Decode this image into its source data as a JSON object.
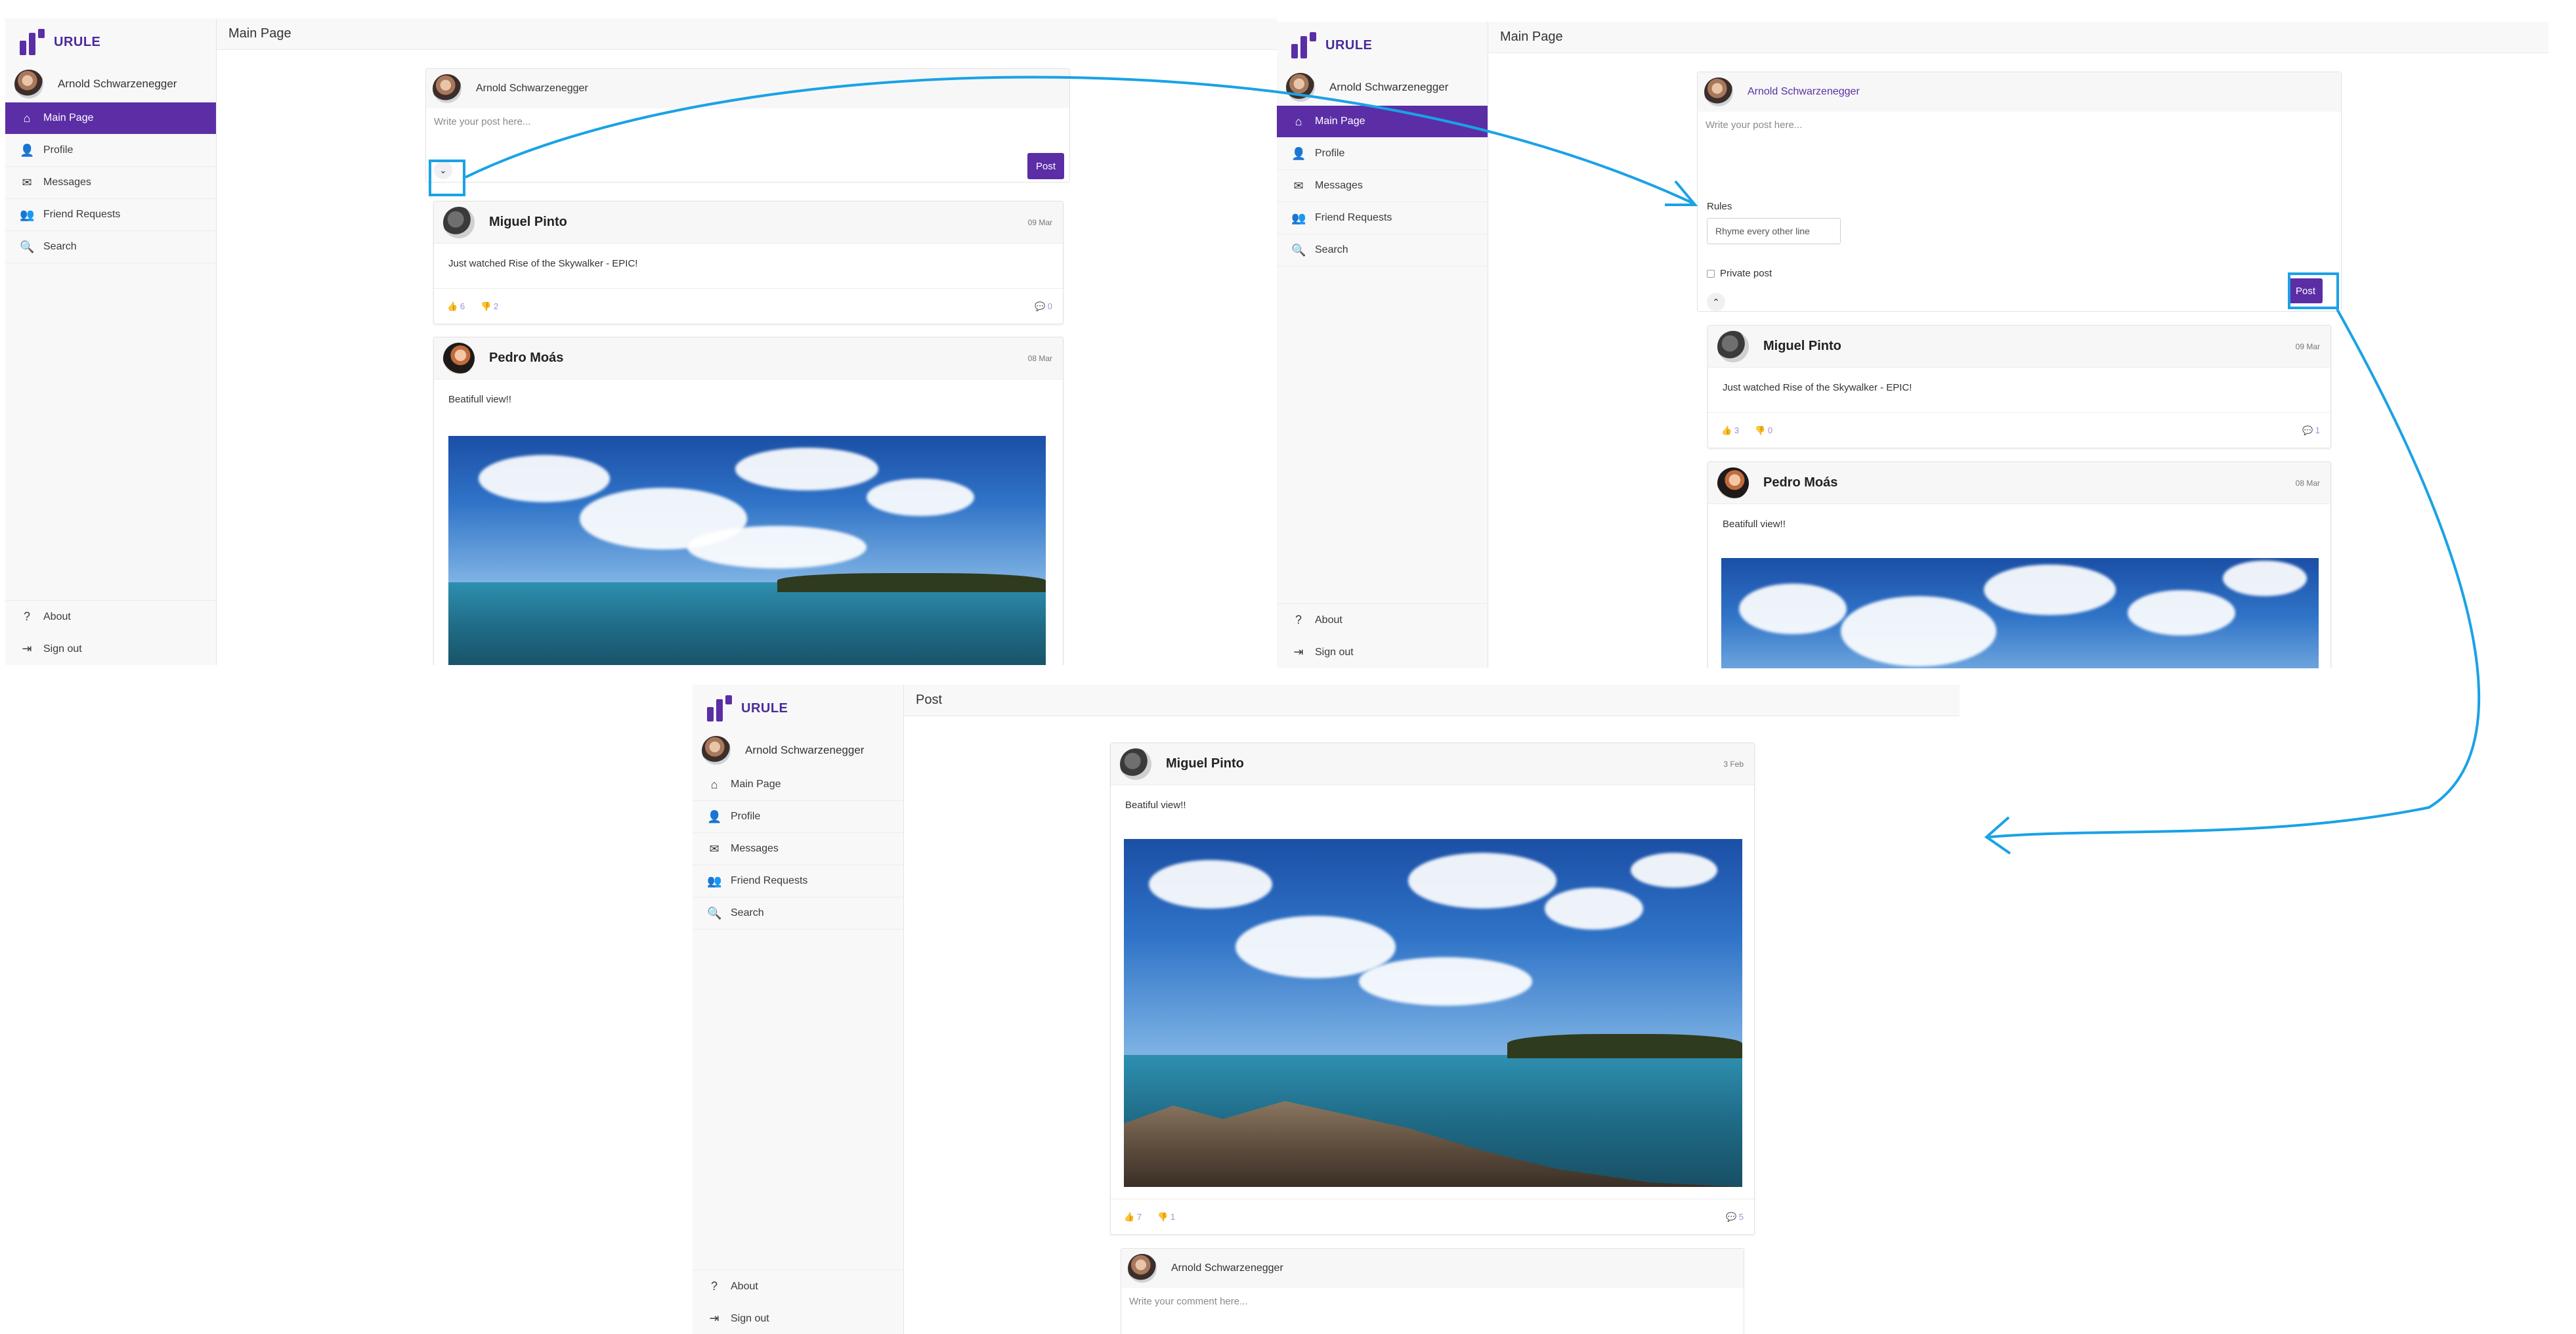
{
  "app": {
    "brand": "URULE",
    "user_name": "Arnold Schwarzenegger"
  },
  "nav": {
    "items": [
      {
        "label": "Main Page",
        "icon": "home-icon"
      },
      {
        "label": "Profile",
        "icon": "user-icon"
      },
      {
        "label": "Messages",
        "icon": "envelope-icon"
      },
      {
        "label": "Friend Requests",
        "icon": "user-plus-icon"
      },
      {
        "label": "Search",
        "icon": "search-icon"
      }
    ],
    "bottom": [
      {
        "label": "About",
        "icon": "question-icon"
      },
      {
        "label": "Sign out",
        "icon": "sign-out-icon"
      }
    ]
  },
  "screen1": {
    "page_title": "Main Page",
    "composer": {
      "author": "Arnold Schwarzenegger",
      "placeholder": "Write your post here...",
      "post_label": "Post"
    },
    "posts": [
      {
        "author": "Miguel Pinto",
        "date": "09 Mar",
        "text": "Just watched Rise of the Skywalker - EPIC!",
        "likes": "6",
        "dislikes": "2",
        "comments": "0"
      },
      {
        "author": "Pedro Moás",
        "date": "08 Mar",
        "text": "Beatifull view!!"
      }
    ]
  },
  "screen2": {
    "page_title": "Main Page",
    "composer": {
      "author": "Arnold Schwarzenegger",
      "placeholder": "Write your post here...",
      "rules_label": "Rules",
      "rules_value": "Rhyme every other line",
      "private_label": "Private post",
      "post_label": "Post"
    },
    "posts": [
      {
        "author": "Miguel Pinto",
        "date": "09 Mar",
        "text": "Just watched Rise of the Skywalker - EPIC!",
        "likes": "3",
        "dislikes": "0",
        "comments": "1"
      },
      {
        "author": "Pedro Moás",
        "date": "08 Mar",
        "text": "Beatifull view!!"
      }
    ]
  },
  "screen3": {
    "page_title": "Post",
    "post": {
      "author": "Miguel Pinto",
      "date": "3 Feb",
      "text": "Beatiful view!!",
      "likes": "7",
      "dislikes": "1",
      "comments": "5"
    },
    "comment_box": {
      "author": "Arnold Schwarzenegger",
      "placeholder": "Write your comment here..."
    }
  },
  "colors": {
    "accent": "#5b2ea6",
    "annotation": "#1aa2e6",
    "reaction": "#9d8fd6"
  }
}
